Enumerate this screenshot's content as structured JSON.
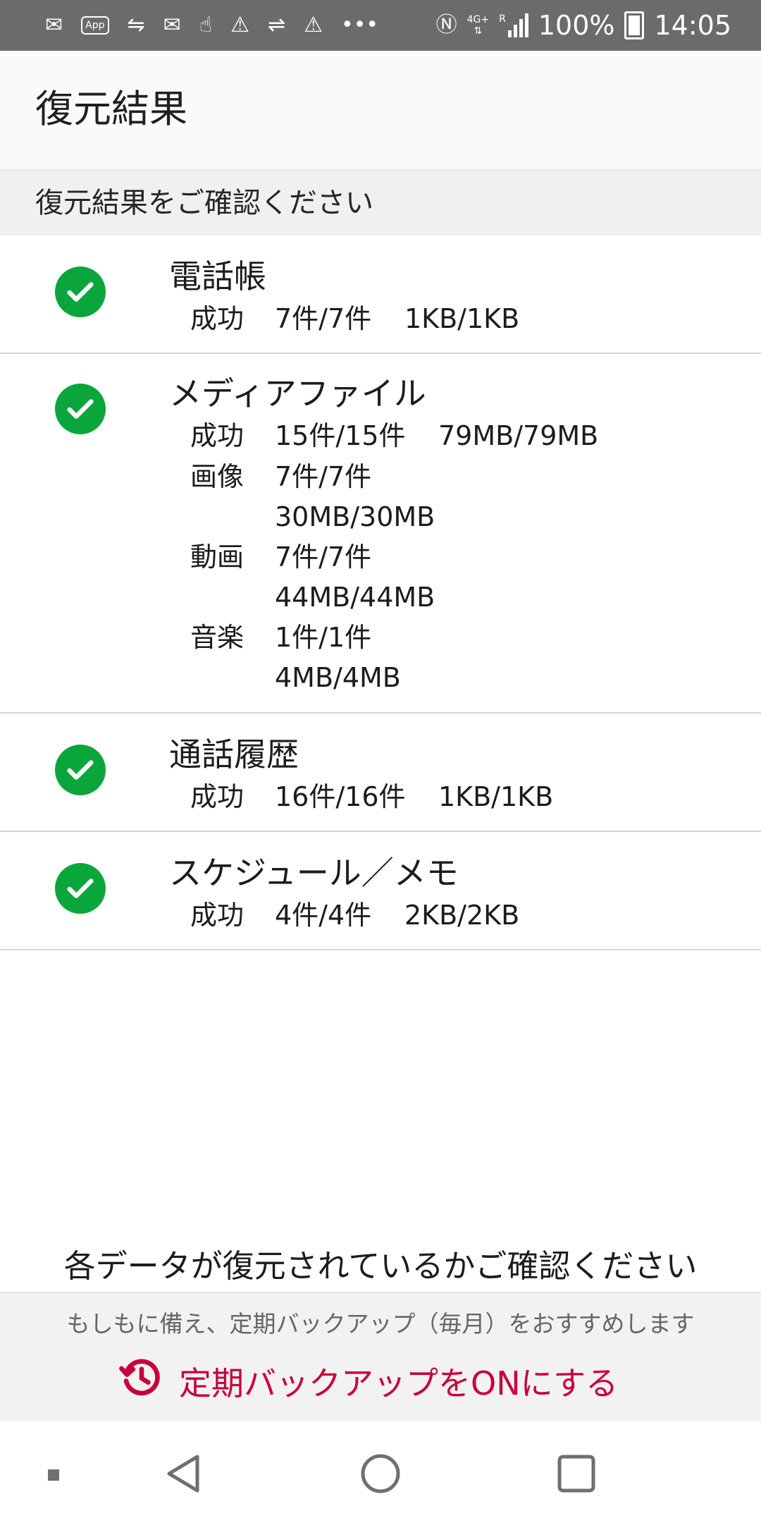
{
  "status_bar": {
    "app_badge": "App",
    "network_badge": "4G+",
    "roaming_badge": "R",
    "battery_text": "100%",
    "time": "14:05",
    "icons": [
      "mail-icon",
      "app-notification-icon",
      "sync-icon",
      "message-icon",
      "gesture-icon",
      "warning-icon",
      "usb-icon",
      "warning-icon",
      "more-notifications-icon",
      "nfc-icon",
      "signal-icon",
      "battery-charging-icon"
    ]
  },
  "app_bar": {
    "title": "復元結果"
  },
  "subheader": {
    "text": "復元結果をご確認ください"
  },
  "results": [
    {
      "title": "電話帳",
      "status_icon": "check-circle-icon",
      "summary": {
        "label": "成功",
        "count": "7件/7件",
        "size": "1KB/1KB"
      }
    },
    {
      "title": "メディアファイル",
      "status_icon": "check-circle-icon",
      "summary": {
        "label": "成功",
        "count": "15件/15件",
        "size": "79MB/79MB"
      },
      "breakdown": [
        {
          "label": "画像",
          "count": "7件/7件",
          "size": "30MB/30MB"
        },
        {
          "label": "動画",
          "count": "7件/7件",
          "size": "44MB/44MB"
        },
        {
          "label": "音楽",
          "count": "1件/1件",
          "size": "4MB/4MB"
        }
      ]
    },
    {
      "title": "通話履歴",
      "status_icon": "check-circle-icon",
      "summary": {
        "label": "成功",
        "count": "16件/16件",
        "size": "1KB/1KB"
      }
    },
    {
      "title": "スケジュール／メモ",
      "status_icon": "check-circle-icon",
      "summary": {
        "label": "成功",
        "count": "4件/4件",
        "size": "2KB/2KB"
      }
    }
  ],
  "footer": {
    "confirm_text": "各データが復元されているかご確認ください",
    "note": "もしもに備え、定期バックアップ（毎月）をおすすめします",
    "action_label": "定期バックアップをONにする",
    "action_icon": "history-clock-icon"
  },
  "colors": {
    "success": "#0aa63c",
    "accent": "#c8003c",
    "status_bar": "#6b6b6b"
  },
  "nav_bar": {
    "icons": [
      "menu-dot-icon",
      "back-icon",
      "home-icon",
      "recents-icon"
    ]
  }
}
